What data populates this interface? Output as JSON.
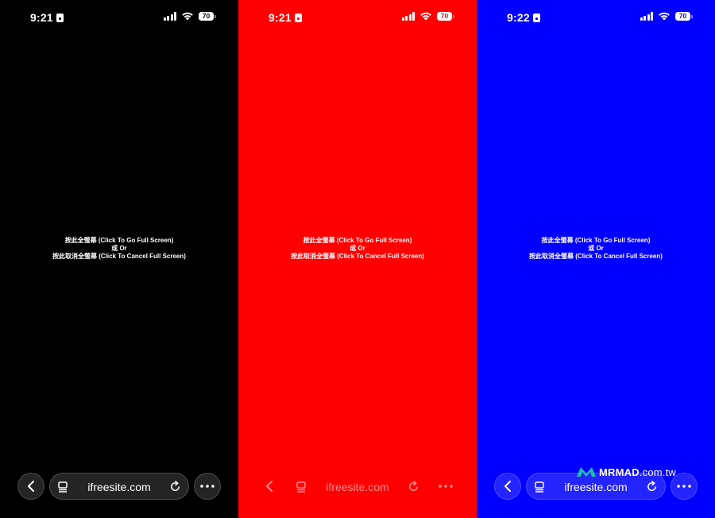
{
  "colors": {
    "phone1_bg": "#000000",
    "phone2_bg": "#ff0000",
    "phone3_bg": "#0000ff",
    "text": "#ffffff",
    "watermark_accent": "#19c2a0"
  },
  "phones": [
    {
      "time": "9:21",
      "battery": "70",
      "url": "ifreesite.com"
    },
    {
      "time": "9:21",
      "battery": "70",
      "url": "ifreesite.com"
    },
    {
      "time": "9:22",
      "battery": "70",
      "url": "ifreesite.com"
    }
  ],
  "message": {
    "line1": "按此全螢幕 (Click To Go Full Screen)",
    "line2": "或 Or",
    "line3": "按此取消全螢幕 (Click To Cancel Full Screen)"
  },
  "icons": [
    "sim-icon",
    "signal-icon",
    "wifi-icon",
    "battery-icon",
    "back-icon",
    "tabs-icon",
    "reload-icon",
    "more-icon"
  ],
  "watermark": {
    "brand": "MRMAD",
    "suffix": ".com.tw"
  }
}
